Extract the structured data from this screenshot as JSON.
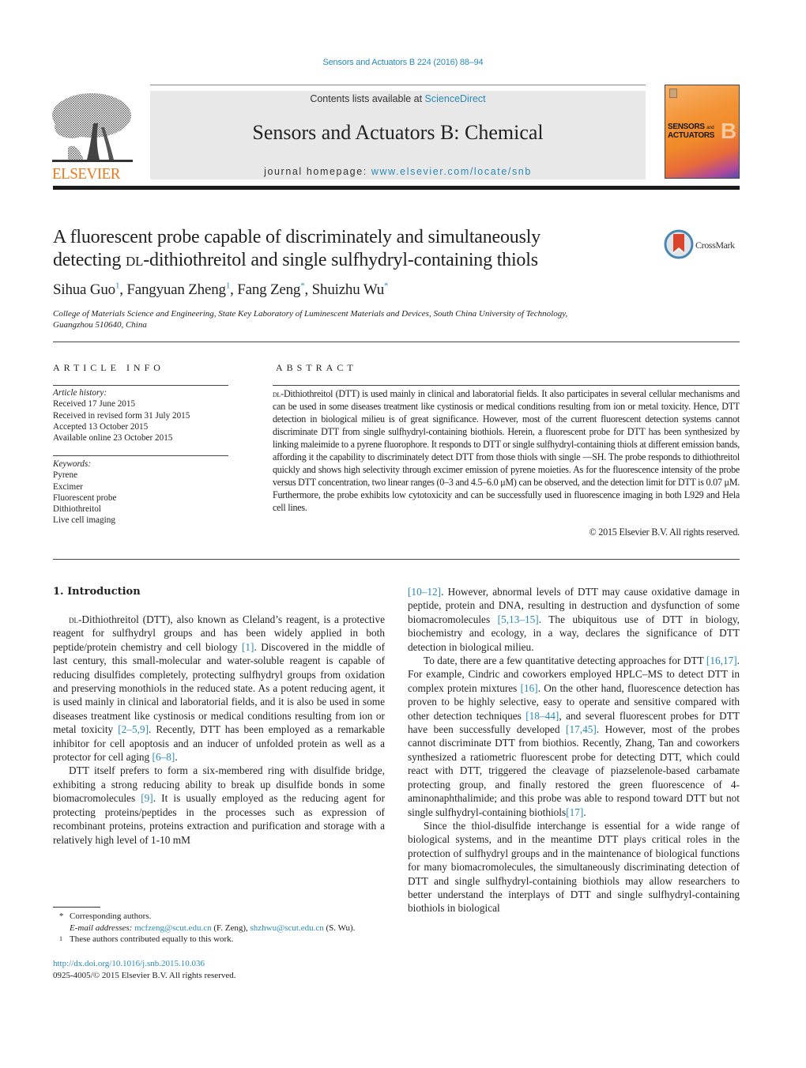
{
  "header": {
    "citation": "Sensors and Actuators B 224 (2016) 88–94",
    "contents_prefix": "Contents lists available at ",
    "contents_link": "ScienceDirect",
    "journal_name": "Sensors and Actuators B: Chemical",
    "homepage_prefix": "journal homepage: ",
    "homepage_link": "www.elsevier.com/locate/snb",
    "publisher_logo": "ELSEVIER",
    "cover": {
      "line1": "SENSORS",
      "line1_small": "and",
      "line2": "ACTUATORS",
      "letter": "B"
    },
    "colors": {
      "link": "#2a8ab5",
      "elsevier_orange": "#e97a1f",
      "masthead_bg": "#e8e8e8"
    }
  },
  "article": {
    "title_line1": "A fluorescent probe capable of discriminately and simultaneously",
    "title_line2_pre": "detecting ",
    "title_line2_sc": "dl",
    "title_line2_post": "-dithiothreitol and single sulfhydryl-containing thiols",
    "crossmark_label": "CrossMark",
    "authors": [
      {
        "name": "Sihua Guo",
        "mark": "1"
      },
      {
        "name": "Fangyuan Zheng",
        "mark": "1"
      },
      {
        "name": "Fang Zeng",
        "mark": "*"
      },
      {
        "name": "Shuizhu Wu",
        "mark": "*"
      }
    ],
    "affiliation_line1": "College of Materials Science and Engineering, State Key Laboratory of Luminescent Materials and Devices, South China University of Technology,",
    "affiliation_line2": "Guangzhou 510640, China"
  },
  "article_info": {
    "heading": "ARTICLE INFO",
    "history_heading": "Article history:",
    "history": [
      "Received 17 June 2015",
      "Received in revised form 31 July 2015",
      "Accepted 13 October 2015",
      "Available online 23 October 2015"
    ],
    "keywords_heading": "Keywords:",
    "keywords": [
      "Pyrene",
      "Excimer",
      "Fluorescent probe",
      "Dithiothreitol",
      "Live cell imaging"
    ]
  },
  "abstract": {
    "heading": "ABSTRACT",
    "sc_prefix": "dl",
    "text": "-Dithiothreitol (DTT) is used mainly in clinical and laboratorial fields. It also participates in several cellular mechanisms and can be used in some diseases treatment like cystinosis or medical conditions resulting from ion or metal toxicity. Hence, DTT detection in biological milieu is of great significance. However, most of the current fluorescent detection systems cannot discriminate DTT from single sulfhydryl-containing biothiols. Herein, a fluorescent probe for DTT has been synthesized by linking maleimide to a pyrene fluorophore. It responds to DTT or single sulfhydryl-containing thiols at different emission bands, affording it the capability to discriminately detect DTT from those thiols with single —SH. The probe responds to dithiothreitol quickly and shows high selectivity through excimer emission of pyrene moieties. As for the fluorescence intensity of the probe versus DTT concentration, two linear ranges (0–3 and 4.5–6.0 μM) can be observed, and the detection limit for DTT is 0.07 μM. Furthermore, the probe exhibits low cytotoxicity and can be successfully used in fluorescence imaging in both L929 and Hela cell lines.",
    "copyright": "© 2015 Elsevier B.V. All rights reserved."
  },
  "body": {
    "section_heading": "1.  Introduction",
    "left": {
      "p1_sc": "dl",
      "p1_a": "-Dithiothreitol (DTT), also known as Cleland’s reagent, is a protective reagent for sulfhydryl groups and has been widely applied in both peptide/protein chemistry and cell biology ",
      "p1_ref1": "[1]",
      "p1_b": ". Discovered in the middle of last century, this small-molecular and water-soluble reagent is capable of reducing disulfides completely, protecting sulfhydryl groups from oxidation and preserving monothiols in the reduced state. As a potent reducing agent, it is used mainly in clinical and laboratorial fields, and it is also be used in some diseases treatment like cystinosis or medical conditions resulting from ion or metal toxicity ",
      "p1_ref2": "[2–5,9]",
      "p1_c": ". Recently, DTT has been employed as a remarkable inhibitor for cell apoptosis and an inducer of unfolded protein as well as a protector for cell aging ",
      "p1_ref3": "[6–8]",
      "p1_d": ".",
      "p2_a": "DTT itself prefers to form a six-membered ring with disulfide bridge, exhibiting a strong reducing ability to break up disulfide bonds in some biomacromolecules ",
      "p2_ref1": "[9]",
      "p2_b": ". It is usually employed as the reducing agent for protecting proteins/peptides in the processes such as expression of recombinant proteins, proteins extraction and purification and storage with a relatively high level of 1-10 mM"
    },
    "right": {
      "p0_ref1": "[10–12]",
      "p0_a": ". However, abnormal levels of DTT may cause oxidative damage in peptide, protein and DNA, resulting in destruction and dysfunction of some biomacromolecules ",
      "p0_ref2": "[5,13–15]",
      "p0_b": ". The ubiquitous use of DTT in biology, biochemistry and ecology, in a way, declares the significance of DTT detection in biological milieu.",
      "p1_a": "To date, there are a few quantitative detecting approaches for DTT ",
      "p1_ref1": "[16,17]",
      "p1_b": ". For example, Cindric and coworkers employed HPLC–MS to detect DTT in complex protein mixtures ",
      "p1_ref2": "[16]",
      "p1_c": ". On the other hand, fluorescence detection has proven to be highly selective, easy to operate and sensitive compared with other detection techniques ",
      "p1_ref3": "[18–44]",
      "p1_d": ", and several fluorescent probes for DTT have been successfully developed ",
      "p1_ref4": "[17,45]",
      "p1_e": ". However, most of the probes cannot discriminate DTT from biothios. Recently, Zhang, Tan and coworkers synthesized a ratiometric fluorescent probe for detecting DTT, which could react with DTT, triggered the cleavage of piazselenole-based carbamate protecting group, and finally restored the green fluorescence of 4-aminonaphthalimide; and this probe was able to respond toward DTT but not single sulfhydryl-containing biothiols",
      "p1_ref5": "[17]",
      "p1_f": ".",
      "p2": "Since the thiol-disulfide interchange is essential for a wide range of biological systems, and in the meantime DTT plays critical roles in the protection of sulfhydryl groups and in the maintenance of biological functions for many biomacromolecules, the simultaneously discriminating detection of DTT and single sulfhydryl-containing biothiols may allow researchers to better understand the interplays of DTT and single sulfhydryl-containing biothiols in biological"
    }
  },
  "footnotes": {
    "star_mark": "*",
    "corresponding": "Corresponding authors.",
    "email_label": "E-mail addresses: ",
    "email1": "mcfzeng@scut.edu.cn",
    "email1_owner": " (F. Zeng), ",
    "email2": "shzhwu@scut.edu.cn",
    "email2_owner": " (S. Wu).",
    "one_mark": "1",
    "equal_contribution": "These authors contributed equally to this work."
  },
  "doi": {
    "link": "http://dx.doi.org/10.1016/j.snb.2015.10.036",
    "issn_copyright": "0925-4005/© 2015 Elsevier B.V. All rights reserved."
  }
}
